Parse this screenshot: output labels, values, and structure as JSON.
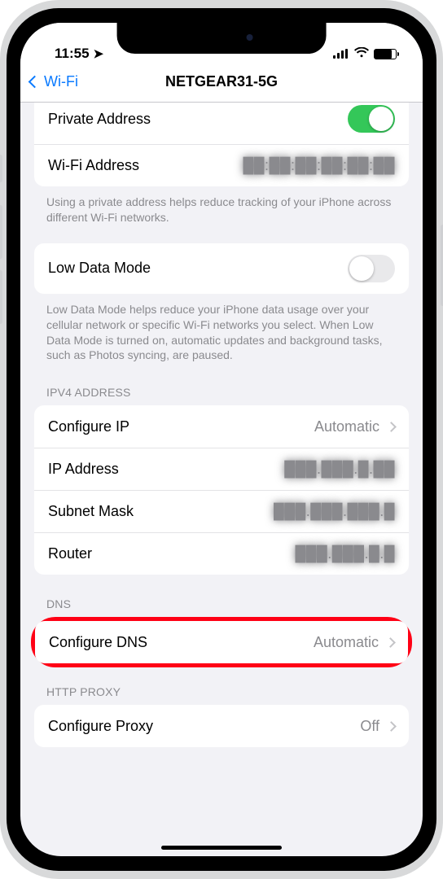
{
  "statusbar": {
    "time": "11:55"
  },
  "nav": {
    "back": "Wi-Fi",
    "title": "NETGEAR31-5G"
  },
  "private_address": {
    "label": "Private Address"
  },
  "wifi_address": {
    "label": "Wi-Fi Address",
    "value": "██:██:██:██:██:██"
  },
  "private_footer": "Using a private address helps reduce tracking of your iPhone across different Wi-Fi networks.",
  "low_data": {
    "label": "Low Data Mode"
  },
  "low_data_footer": "Low Data Mode helps reduce your iPhone data usage over your cellular network or specific Wi-Fi networks you select. When Low Data Mode is turned on, automatic updates and background tasks, such as Photos syncing, are paused.",
  "ipv4": {
    "header": "IPV4 ADDRESS",
    "configure_ip": {
      "label": "Configure IP",
      "value": "Automatic"
    },
    "ip_address": {
      "label": "IP Address",
      "value": "███.███.█.██"
    },
    "subnet": {
      "label": "Subnet Mask",
      "value": "███.███.███.█"
    },
    "router": {
      "label": "Router",
      "value": "███.███.█.█"
    }
  },
  "dns": {
    "header": "DNS",
    "configure": {
      "label": "Configure DNS",
      "value": "Automatic"
    }
  },
  "proxy": {
    "header": "HTTP PROXY",
    "configure": {
      "label": "Configure Proxy",
      "value": "Off"
    }
  }
}
